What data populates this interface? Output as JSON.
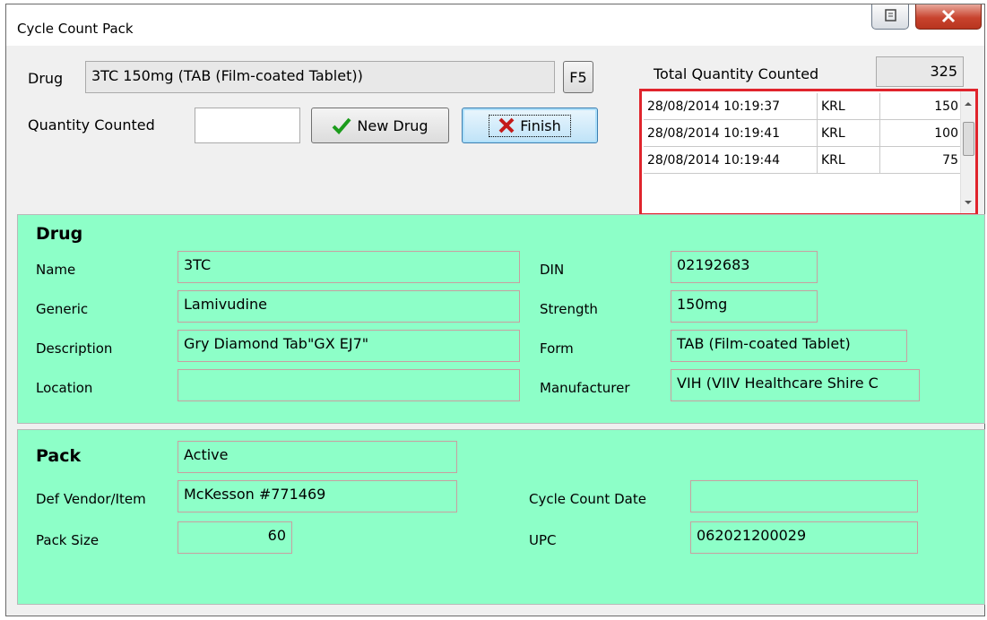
{
  "window": {
    "title": "Cycle Count Pack"
  },
  "top": {
    "drug_label": "Drug",
    "drug_value": "3TC 150mg (TAB (Film-coated Tablet))",
    "f5_label": "F5",
    "qty_label": "Quantity Counted",
    "qty_value": "",
    "new_drug_label": "New Drug",
    "finish_label": "Finish",
    "total_label": "Total Quantity Counted",
    "total_value": "325"
  },
  "counts": [
    {
      "timestamp": "28/08/2014 10:19:37",
      "user": "KRL",
      "qty": "150"
    },
    {
      "timestamp": "28/08/2014 10:19:41",
      "user": "KRL",
      "qty": "100"
    },
    {
      "timestamp": "28/08/2014 10:19:44",
      "user": "KRL",
      "qty": "75"
    }
  ],
  "drug": {
    "header": "Drug",
    "name_label": "Name",
    "name": "3TC",
    "generic_label": "Generic",
    "generic": "Lamivudine",
    "description_label": "Description",
    "description": "Gry Diamond Tab\"GX EJ7\"",
    "location_label": "Location",
    "location": "",
    "din_label": "DIN",
    "din": "02192683",
    "strength_label": "Strength",
    "strength": "150mg",
    "form_label": "Form",
    "form": "TAB (Film-coated Tablet)",
    "manufacturer_label": "Manufacturer",
    "manufacturer": "VIH (VIIV Healthcare Shire C"
  },
  "pack": {
    "header": "Pack",
    "status": "Active",
    "vendor_label": "Def Vendor/Item",
    "vendor": "McKesson #771469",
    "pack_size_label": "Pack Size",
    "pack_size": "60",
    "cycle_date_label": "Cycle Count Date",
    "cycle_date": "",
    "upc_label": "UPC",
    "upc": "062021200029"
  },
  "colors": {
    "green_panel": "#8dffc8",
    "highlight_border": "#e0242c"
  },
  "icons": [
    "restore-icon",
    "close-icon",
    "checkmark-icon",
    "x-icon",
    "scroll-up-icon",
    "scroll-down-icon"
  ]
}
